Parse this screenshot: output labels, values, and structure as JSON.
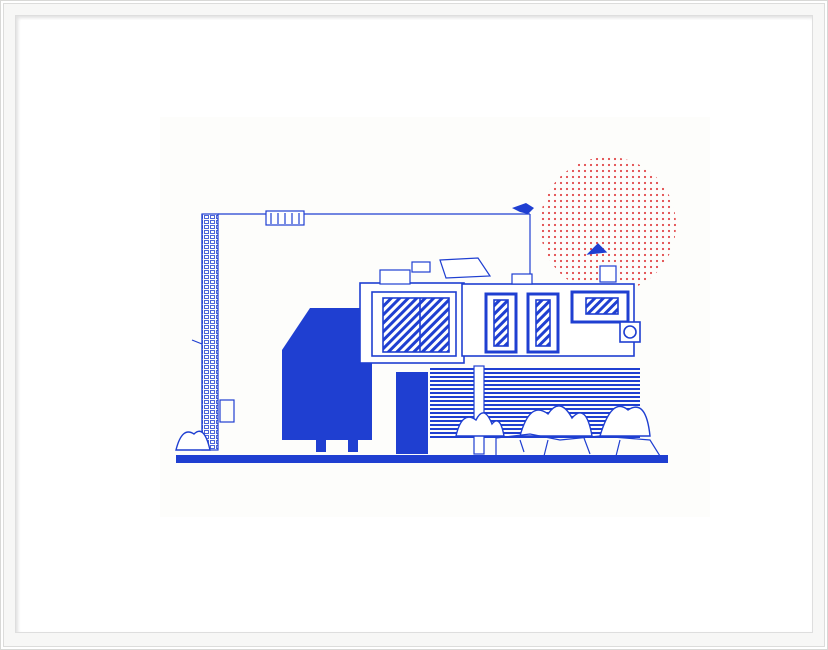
{
  "artwork": {
    "caption": "",
    "colors": {
      "ink_blue": "#1f3fd1",
      "halftone_red": "#e2484a",
      "paper": "#fdfdfb",
      "frame": "#f7f7f6"
    }
  }
}
